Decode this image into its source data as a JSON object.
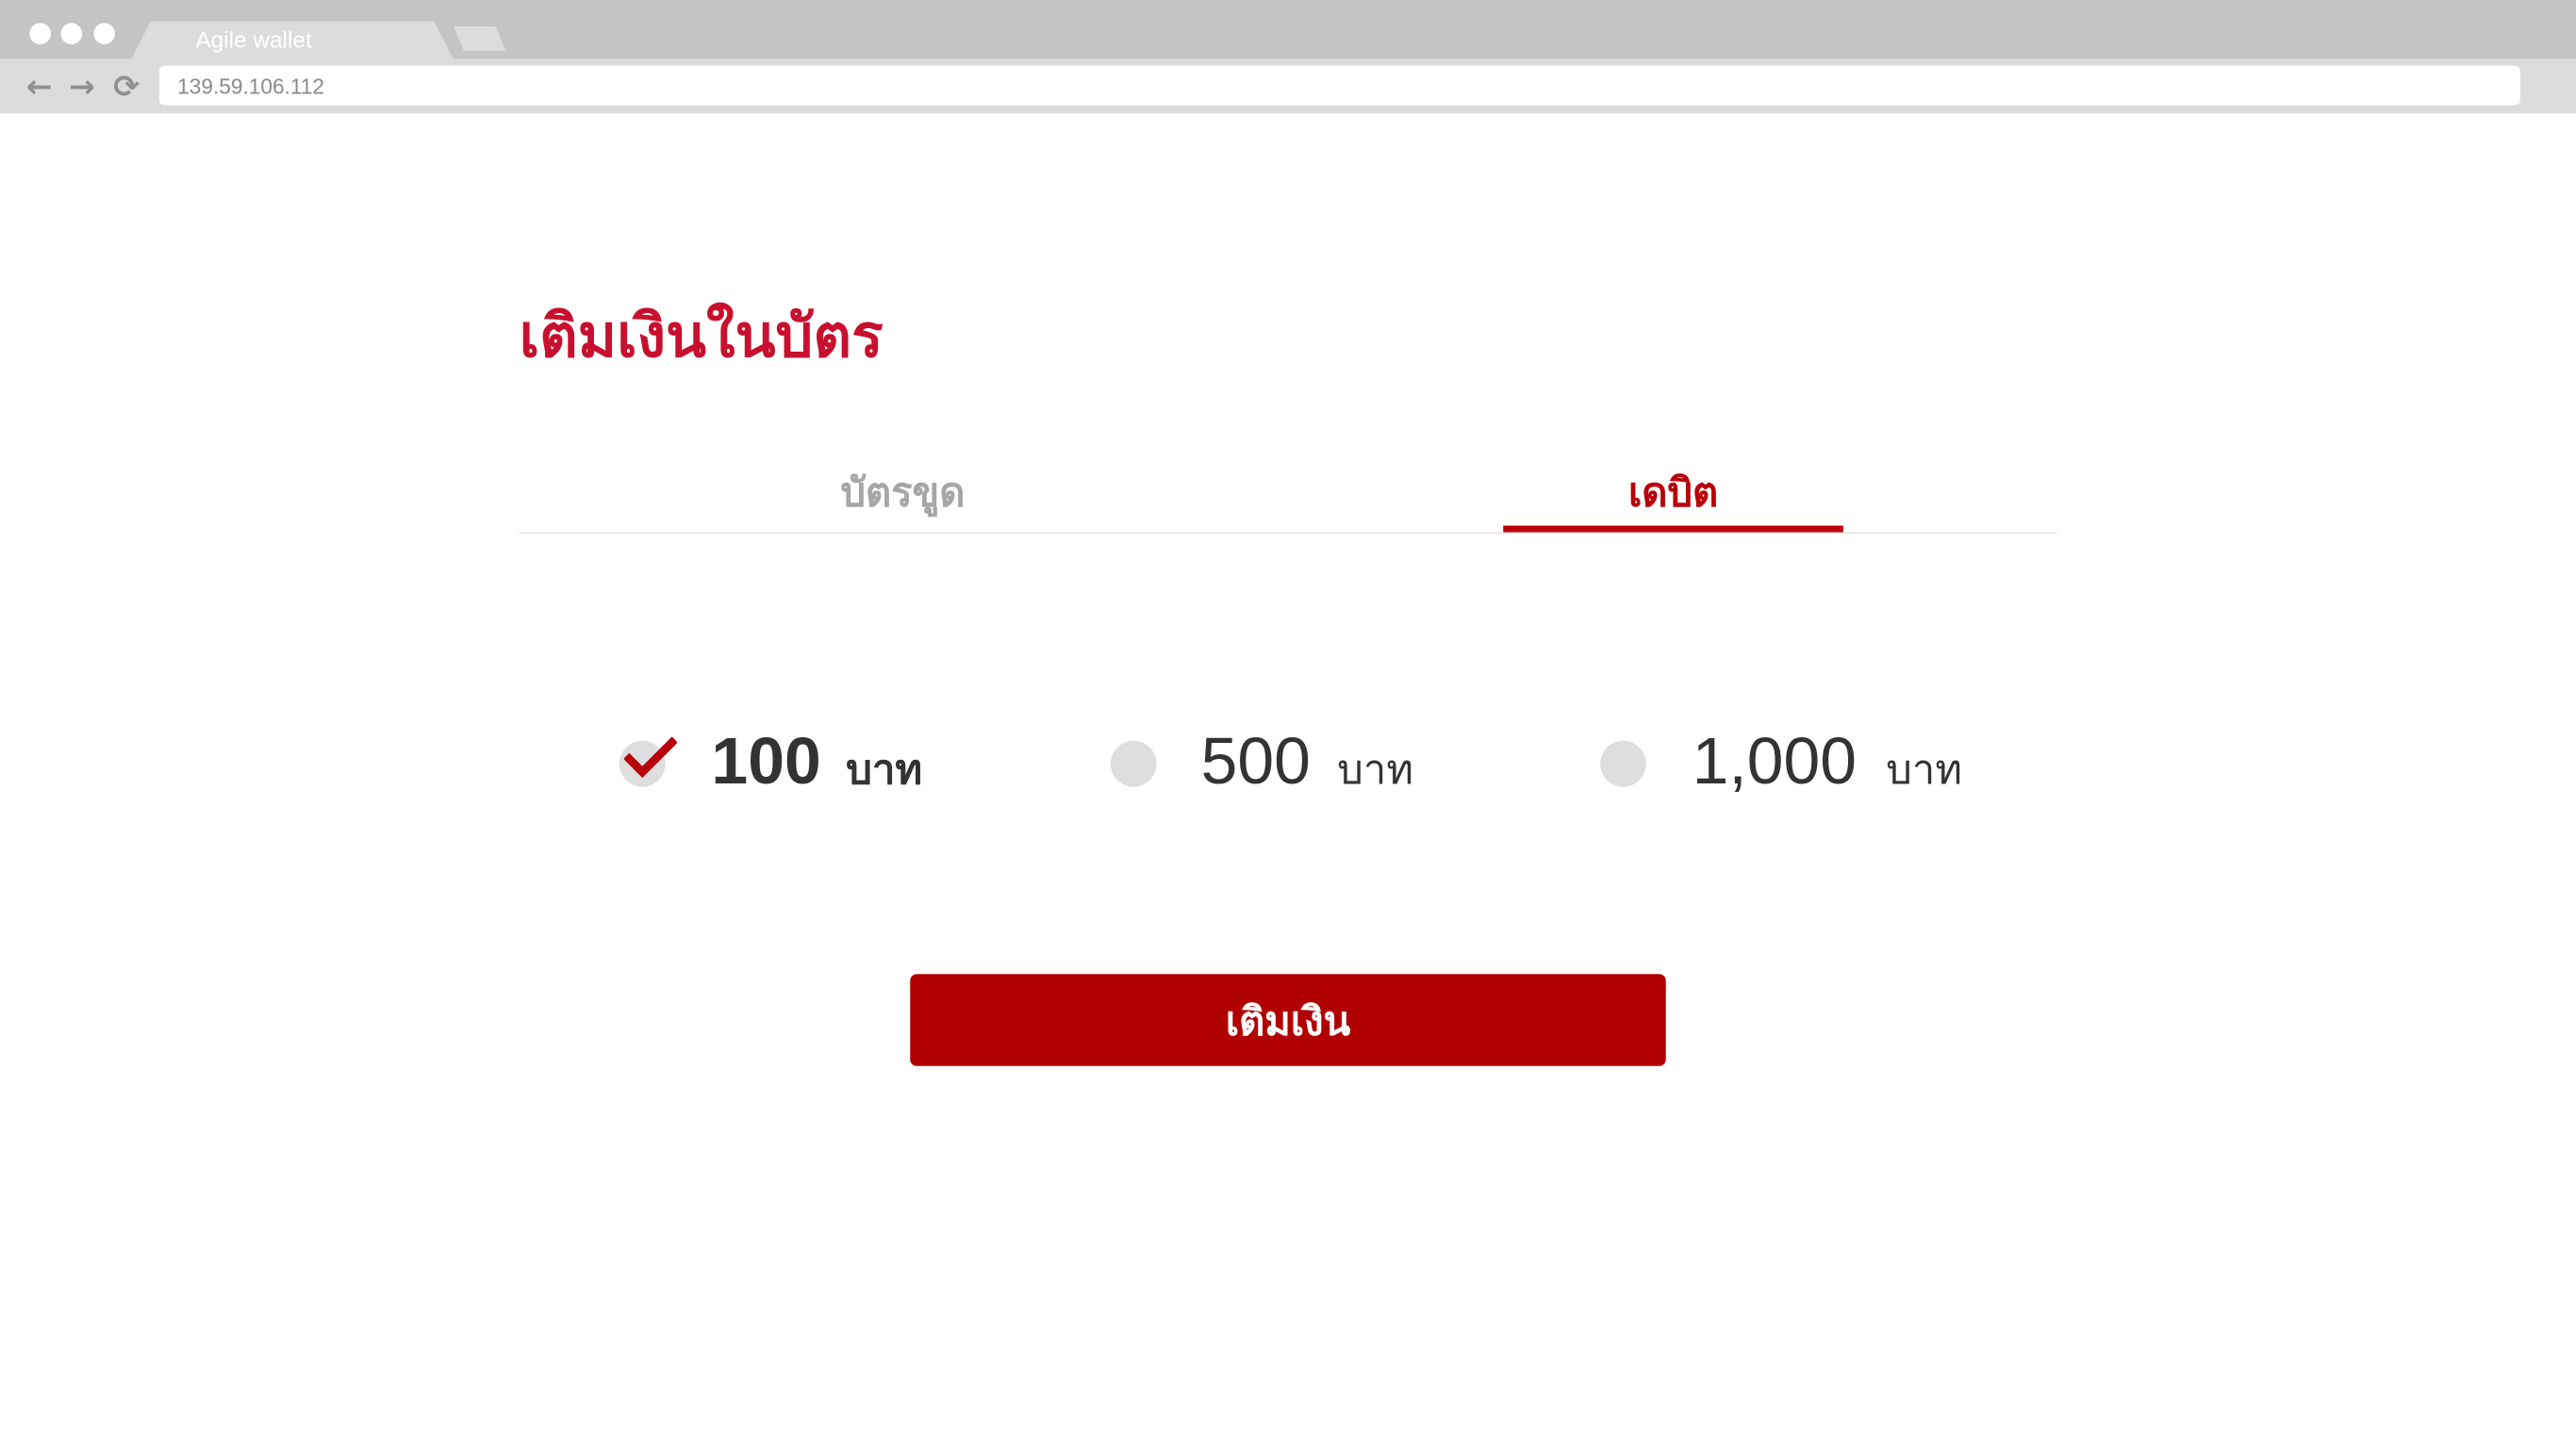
{
  "browser": {
    "tab_title": "Agile wallet",
    "url": "139.59.106.112",
    "back_icon": "←",
    "forward_icon": "→",
    "reload_icon": "⟳"
  },
  "page": {
    "title": "เติมเงินในบัตร",
    "tabs": [
      {
        "label": "บัตรขูด",
        "active": false
      },
      {
        "label": "เดบิต",
        "active": true
      }
    ],
    "amount_options": [
      {
        "value": "100",
        "unit": "บาท",
        "selected": true
      },
      {
        "value": "500",
        "unit": "บาท",
        "selected": false
      },
      {
        "value": "1,000",
        "unit": "บาท",
        "selected": false
      }
    ],
    "submit_label": "เติมเงิน"
  },
  "colors": {
    "brand": "#b8000a",
    "title": "#c8102e",
    "button": "#b10000"
  }
}
